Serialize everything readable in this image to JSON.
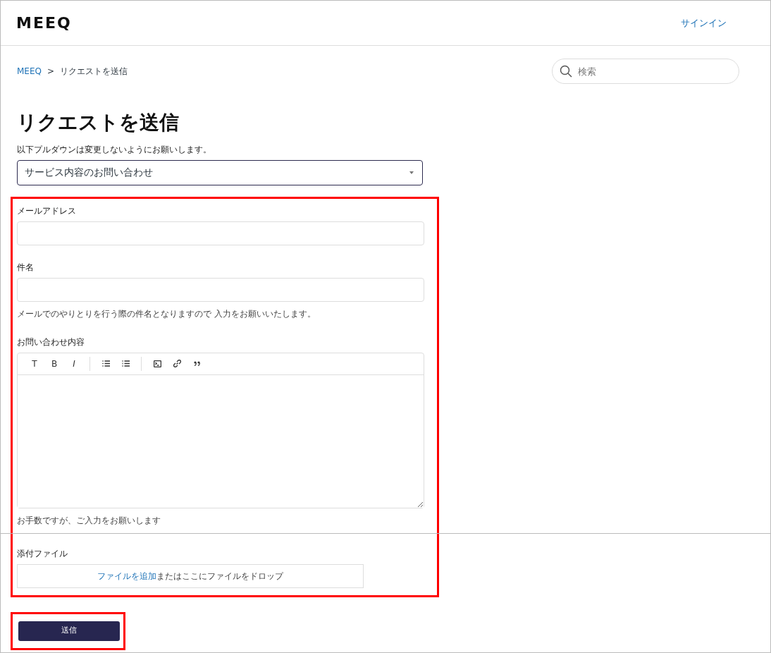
{
  "header": {
    "logo": "MEEQ",
    "signin": "サインイン"
  },
  "breadcrumb": [
    {
      "label": "MEEQ",
      "link": true
    },
    {
      "label": "リクエストを送信",
      "link": false
    }
  ],
  "breadcrumb_separator": ">",
  "search": {
    "placeholder": "検索"
  },
  "title": "リクエストを送信",
  "form": {
    "dropdown_label": "以下プルダウンは変更しないようにお願いします。",
    "dropdown_value": "サービス内容のお問い合わせ",
    "fields": [
      {
        "kind": "input",
        "label": "メールアドレス"
      },
      {
        "kind": "input",
        "label": "件名",
        "hint": "メールでのやりとりを行う際の件名となりますので 入力をお願いいたします。"
      },
      {
        "kind": "editor",
        "label": "お問い合わせ内容",
        "hint": "お手数ですが、ご入力をお願いします",
        "toolbar": [
          "T",
          "B",
          "I"
        ]
      }
    ],
    "attachment": {
      "label": "添付ファイル",
      "link": "ファイルを追加",
      "text": "またはここにファイルをドロップ"
    },
    "submit": "送信"
  }
}
